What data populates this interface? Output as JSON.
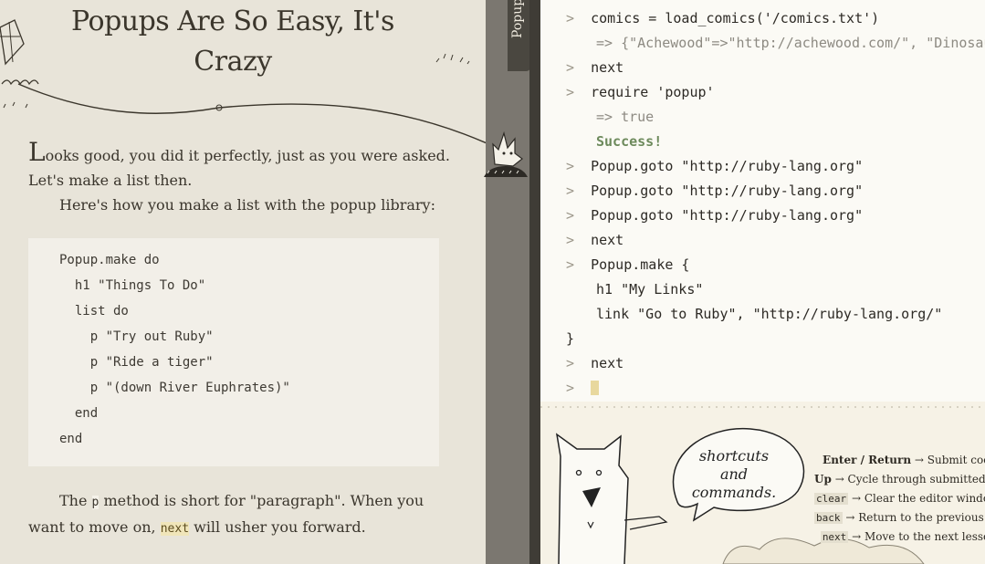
{
  "lesson": {
    "title": "Popups Are So Easy, It's Crazy",
    "p1_dropcap": "L",
    "p1_rest": "ooks good, you did it perfectly, just as you were asked. Let's make a list then.",
    "p2": "Here's how you make a list with the popup library:",
    "code": [
      "Popup.make do",
      "  h1 \"Things To Do\"",
      "  list do",
      "    p \"Try out Ruby\"",
      "    p \"Ride a tiger\"",
      "    p \"(down River Euphrates)\"",
      "  end",
      "end"
    ],
    "p3_a": "The ",
    "p3_code": "p",
    "p3_b": " method is short for \"paragraph\". When you want to move on, ",
    "p3_next": "next",
    "p3_c": " will usher you forward."
  },
  "divider": {
    "label": "Popup"
  },
  "console": {
    "prompt": ">",
    "lines": [
      {
        "kind": "in",
        "text": "comics = load_comics('/comics.txt')"
      },
      {
        "kind": "out",
        "text": "=> {\"Achewood\"=>\"http://achewood.com/\", \"Dinosaur Comics\""
      },
      {
        "kind": "in",
        "text": "next"
      },
      {
        "kind": "in",
        "text": "require 'popup'"
      },
      {
        "kind": "out",
        "text": "=> true"
      },
      {
        "kind": "success",
        "text": "Success!"
      },
      {
        "kind": "in",
        "text": "Popup.goto \"http://ruby-lang.org\""
      },
      {
        "kind": "in",
        "text": "Popup.goto \"http://ruby-lang.org\""
      },
      {
        "kind": "in",
        "text": "Popup.goto \"http://ruby-lang.org\""
      },
      {
        "kind": "in",
        "text": "next"
      },
      {
        "kind": "in",
        "text": "Popup.make {"
      },
      {
        "kind": "cont",
        "text": "h1 \"My Links\""
      },
      {
        "kind": "cont",
        "text": "link \"Go to Ruby\", \"http://ruby-lang.org/\""
      },
      {
        "kind": "close",
        "text": "}"
      },
      {
        "kind": "in",
        "text": "next"
      }
    ]
  },
  "help": {
    "bubble": "shortcuts and commands.",
    "shortcuts": [
      {
        "key": "Enter / Return",
        "desc": "→ Submit code"
      },
      {
        "key": "Up",
        "desc": "→ Cycle through submitted code"
      },
      {
        "key": "clear",
        "desc": "→ Clear the editor window"
      },
      {
        "key": "back",
        "desc": "→ Return to the previous lesson"
      },
      {
        "key": "next",
        "desc": "→ Move to the next lesson"
      }
    ]
  },
  "colors": {
    "console_bg": "#fbfaf5",
    "lesson_bg": "#e8e4d9",
    "divider": "#7b7770",
    "success": "#6d8a5c"
  }
}
